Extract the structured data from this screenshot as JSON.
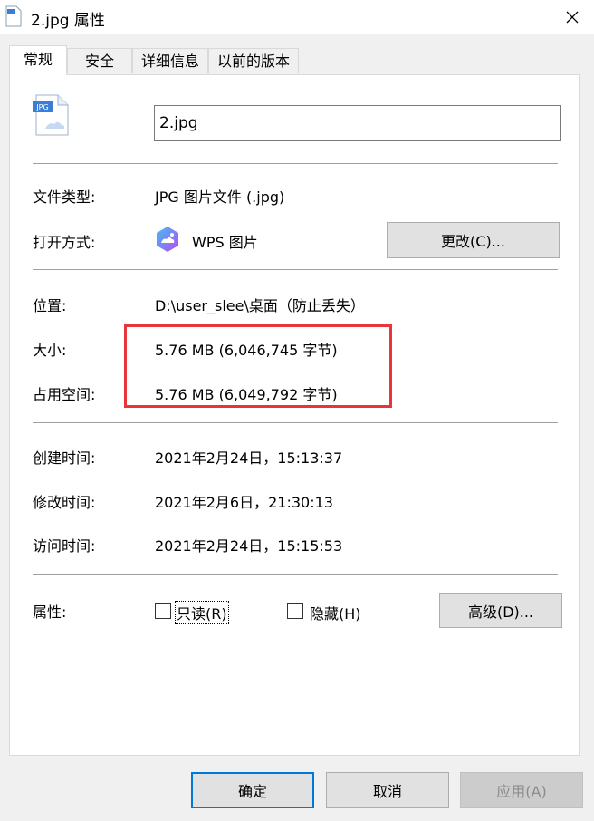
{
  "window": {
    "title": "2.jpg 属性"
  },
  "tabs": [
    {
      "label": "常规",
      "active": true
    },
    {
      "label": "安全"
    },
    {
      "label": "详细信息"
    },
    {
      "label": "以前的版本"
    }
  ],
  "file": {
    "name": "2.jpg",
    "icon_text": "JPG"
  },
  "rows": {
    "type": {
      "label": "文件类型:",
      "value": "JPG 图片文件 (.jpg)"
    },
    "open_with": {
      "label": "打开方式:",
      "value": "WPS 图片",
      "change_button": "更改(C)..."
    },
    "location": {
      "label": "位置:",
      "value": "D:\\user_slee\\桌面（防止丢失）"
    },
    "size": {
      "label": "大小:",
      "value": "5.76 MB (6,046,745 字节)"
    },
    "size_on_disk": {
      "label": "占用空间:",
      "value": "5.76 MB (6,049,792 字节)"
    },
    "created": {
      "label": "创建时间:",
      "value": "2021年2月24日，15:13:37"
    },
    "modified": {
      "label": "修改时间:",
      "value": "2021年2月6日，21:30:13"
    },
    "accessed": {
      "label": "访问时间:",
      "value": "2021年2月24日，15:15:53"
    }
  },
  "attributes": {
    "label": "属性:",
    "readonly": {
      "label": "只读(R)",
      "checked": false
    },
    "hidden": {
      "label": "隐藏(H)",
      "checked": false
    },
    "advanced_button": "高级(D)..."
  },
  "footer": {
    "ok": "确定",
    "cancel": "取消",
    "apply": "应用(A)"
  },
  "colors": {
    "highlight": "#e8353a",
    "focus": "#0078d7"
  }
}
